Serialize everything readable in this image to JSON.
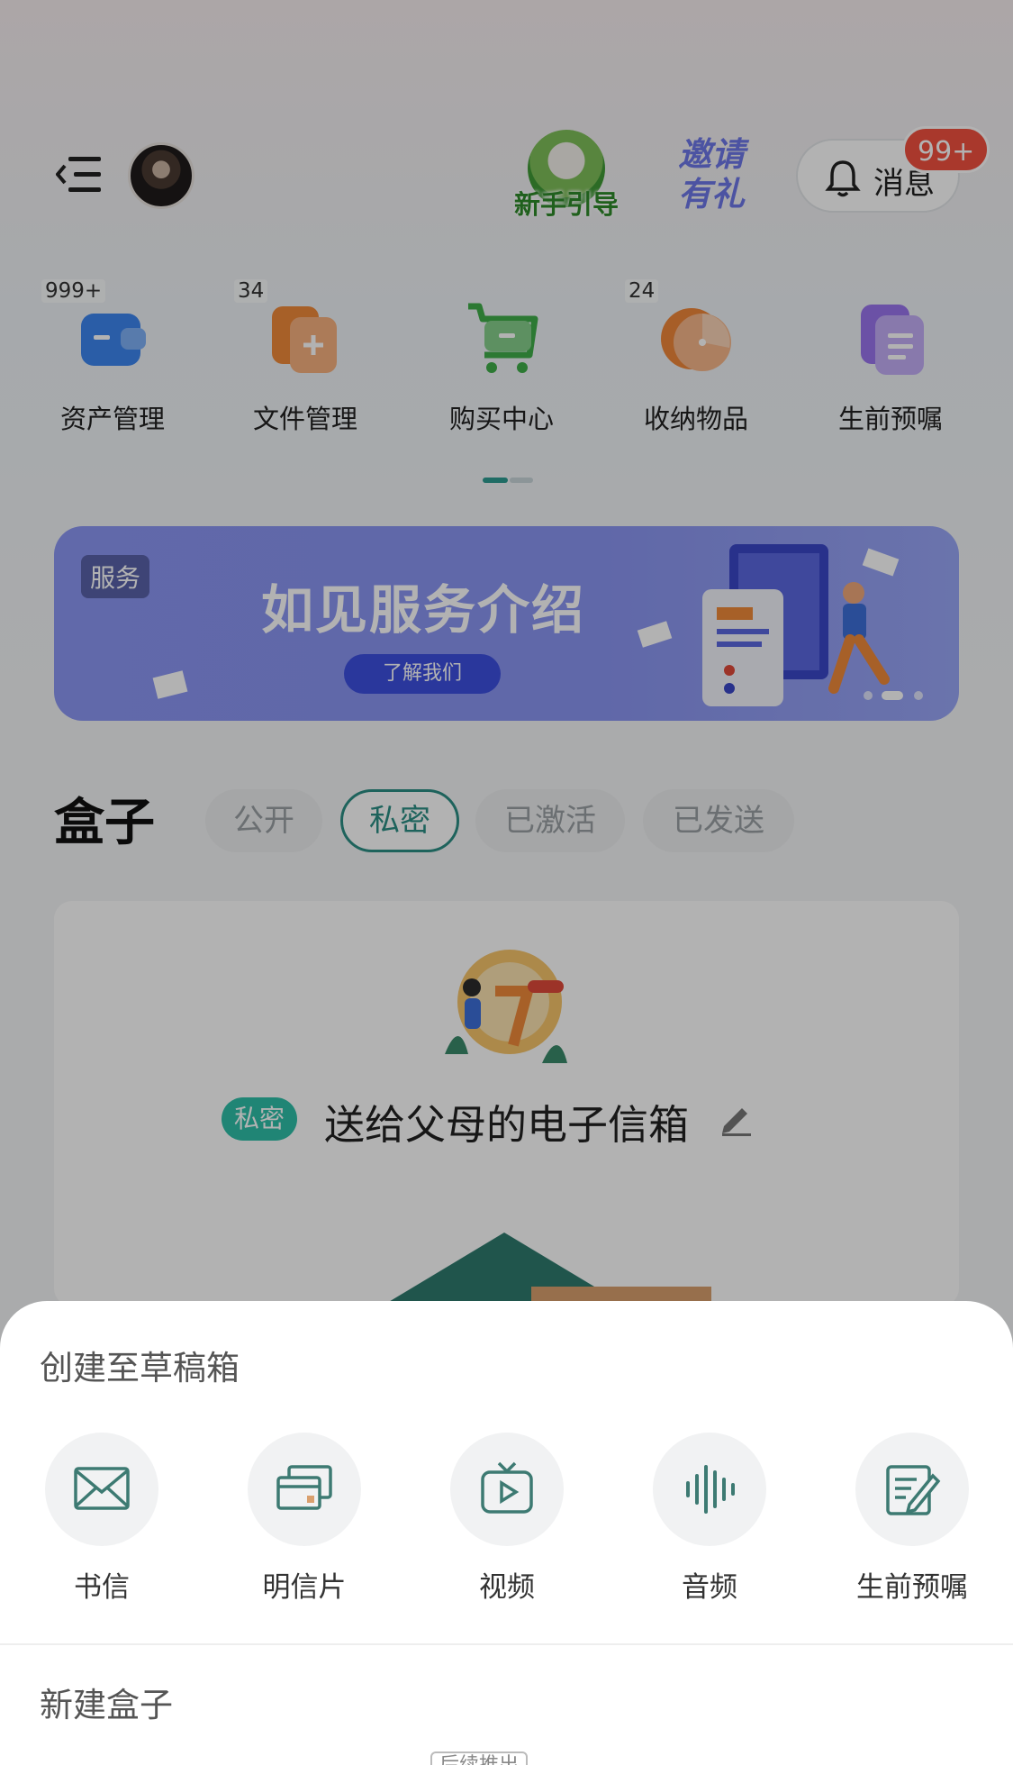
{
  "header": {
    "guide_label": "新手引导",
    "invite_line1": "邀请",
    "invite_line2": "有礼",
    "messages_label": "消息",
    "messages_badge": "99+"
  },
  "quick_actions": [
    {
      "label": "资产管理",
      "count": "999+",
      "icon": "wallet-icon",
      "color": "#3d86f0"
    },
    {
      "label": "文件管理",
      "count": "34",
      "icon": "file-add-icon",
      "color": "#f08a3a"
    },
    {
      "label": "购买中心",
      "count": "",
      "icon": "cart-icon",
      "color": "#3fae4a"
    },
    {
      "label": "收纳物品",
      "count": "24",
      "icon": "storage-icon",
      "color": "#f0873a"
    },
    {
      "label": "生前预嘱",
      "count": "",
      "icon": "document-icon",
      "color": "#9a74ee"
    }
  ],
  "banner": {
    "tag": "服务",
    "title": "如见服务介绍",
    "button": "了解我们"
  },
  "boxes": {
    "heading": "盒子",
    "filters": [
      "公开",
      "私密",
      "已激活",
      "已发送"
    ],
    "active_filter": "私密"
  },
  "card": {
    "badge": "私密",
    "title": "送给父母的电子信箱"
  },
  "sheet": {
    "title": "创建至草稿箱",
    "items": [
      {
        "label": "书信",
        "icon": "letter-icon"
      },
      {
        "label": "明信片",
        "icon": "postcard-icon"
      },
      {
        "label": "视频",
        "icon": "video-icon"
      },
      {
        "label": "音频",
        "icon": "audio-icon"
      },
      {
        "label": "生前预嘱",
        "icon": "will-edit-icon"
      }
    ],
    "new_box": "新建盒子",
    "coming_soon": "后续推出"
  }
}
